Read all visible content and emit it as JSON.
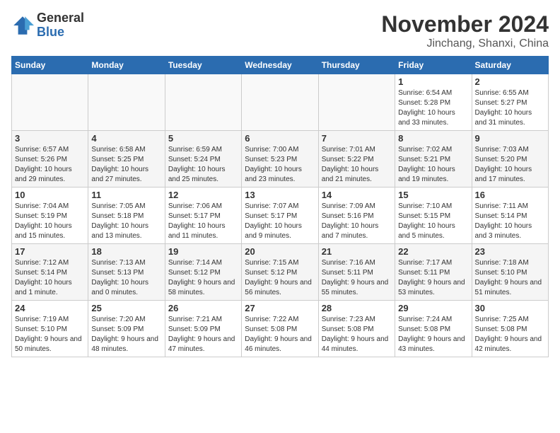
{
  "header": {
    "logo_general": "General",
    "logo_blue": "Blue",
    "month_title": "November 2024",
    "location": "Jinchang, Shanxi, China"
  },
  "days_of_week": [
    "Sunday",
    "Monday",
    "Tuesday",
    "Wednesday",
    "Thursday",
    "Friday",
    "Saturday"
  ],
  "weeks": [
    [
      {
        "day": "",
        "info": ""
      },
      {
        "day": "",
        "info": ""
      },
      {
        "day": "",
        "info": ""
      },
      {
        "day": "",
        "info": ""
      },
      {
        "day": "",
        "info": ""
      },
      {
        "day": "1",
        "info": "Sunrise: 6:54 AM\nSunset: 5:28 PM\nDaylight: 10 hours and 33 minutes."
      },
      {
        "day": "2",
        "info": "Sunrise: 6:55 AM\nSunset: 5:27 PM\nDaylight: 10 hours and 31 minutes."
      }
    ],
    [
      {
        "day": "3",
        "info": "Sunrise: 6:57 AM\nSunset: 5:26 PM\nDaylight: 10 hours and 29 minutes."
      },
      {
        "day": "4",
        "info": "Sunrise: 6:58 AM\nSunset: 5:25 PM\nDaylight: 10 hours and 27 minutes."
      },
      {
        "day": "5",
        "info": "Sunrise: 6:59 AM\nSunset: 5:24 PM\nDaylight: 10 hours and 25 minutes."
      },
      {
        "day": "6",
        "info": "Sunrise: 7:00 AM\nSunset: 5:23 PM\nDaylight: 10 hours and 23 minutes."
      },
      {
        "day": "7",
        "info": "Sunrise: 7:01 AM\nSunset: 5:22 PM\nDaylight: 10 hours and 21 minutes."
      },
      {
        "day": "8",
        "info": "Sunrise: 7:02 AM\nSunset: 5:21 PM\nDaylight: 10 hours and 19 minutes."
      },
      {
        "day": "9",
        "info": "Sunrise: 7:03 AM\nSunset: 5:20 PM\nDaylight: 10 hours and 17 minutes."
      }
    ],
    [
      {
        "day": "10",
        "info": "Sunrise: 7:04 AM\nSunset: 5:19 PM\nDaylight: 10 hours and 15 minutes."
      },
      {
        "day": "11",
        "info": "Sunrise: 7:05 AM\nSunset: 5:18 PM\nDaylight: 10 hours and 13 minutes."
      },
      {
        "day": "12",
        "info": "Sunrise: 7:06 AM\nSunset: 5:17 PM\nDaylight: 10 hours and 11 minutes."
      },
      {
        "day": "13",
        "info": "Sunrise: 7:07 AM\nSunset: 5:17 PM\nDaylight: 10 hours and 9 minutes."
      },
      {
        "day": "14",
        "info": "Sunrise: 7:09 AM\nSunset: 5:16 PM\nDaylight: 10 hours and 7 minutes."
      },
      {
        "day": "15",
        "info": "Sunrise: 7:10 AM\nSunset: 5:15 PM\nDaylight: 10 hours and 5 minutes."
      },
      {
        "day": "16",
        "info": "Sunrise: 7:11 AM\nSunset: 5:14 PM\nDaylight: 10 hours and 3 minutes."
      }
    ],
    [
      {
        "day": "17",
        "info": "Sunrise: 7:12 AM\nSunset: 5:14 PM\nDaylight: 10 hours and 1 minute."
      },
      {
        "day": "18",
        "info": "Sunrise: 7:13 AM\nSunset: 5:13 PM\nDaylight: 10 hours and 0 minutes."
      },
      {
        "day": "19",
        "info": "Sunrise: 7:14 AM\nSunset: 5:12 PM\nDaylight: 9 hours and 58 minutes."
      },
      {
        "day": "20",
        "info": "Sunrise: 7:15 AM\nSunset: 5:12 PM\nDaylight: 9 hours and 56 minutes."
      },
      {
        "day": "21",
        "info": "Sunrise: 7:16 AM\nSunset: 5:11 PM\nDaylight: 9 hours and 55 minutes."
      },
      {
        "day": "22",
        "info": "Sunrise: 7:17 AM\nSunset: 5:11 PM\nDaylight: 9 hours and 53 minutes."
      },
      {
        "day": "23",
        "info": "Sunrise: 7:18 AM\nSunset: 5:10 PM\nDaylight: 9 hours and 51 minutes."
      }
    ],
    [
      {
        "day": "24",
        "info": "Sunrise: 7:19 AM\nSunset: 5:10 PM\nDaylight: 9 hours and 50 minutes."
      },
      {
        "day": "25",
        "info": "Sunrise: 7:20 AM\nSunset: 5:09 PM\nDaylight: 9 hours and 48 minutes."
      },
      {
        "day": "26",
        "info": "Sunrise: 7:21 AM\nSunset: 5:09 PM\nDaylight: 9 hours and 47 minutes."
      },
      {
        "day": "27",
        "info": "Sunrise: 7:22 AM\nSunset: 5:08 PM\nDaylight: 9 hours and 46 minutes."
      },
      {
        "day": "28",
        "info": "Sunrise: 7:23 AM\nSunset: 5:08 PM\nDaylight: 9 hours and 44 minutes."
      },
      {
        "day": "29",
        "info": "Sunrise: 7:24 AM\nSunset: 5:08 PM\nDaylight: 9 hours and 43 minutes."
      },
      {
        "day": "30",
        "info": "Sunrise: 7:25 AM\nSunset: 5:08 PM\nDaylight: 9 hours and 42 minutes."
      }
    ]
  ]
}
